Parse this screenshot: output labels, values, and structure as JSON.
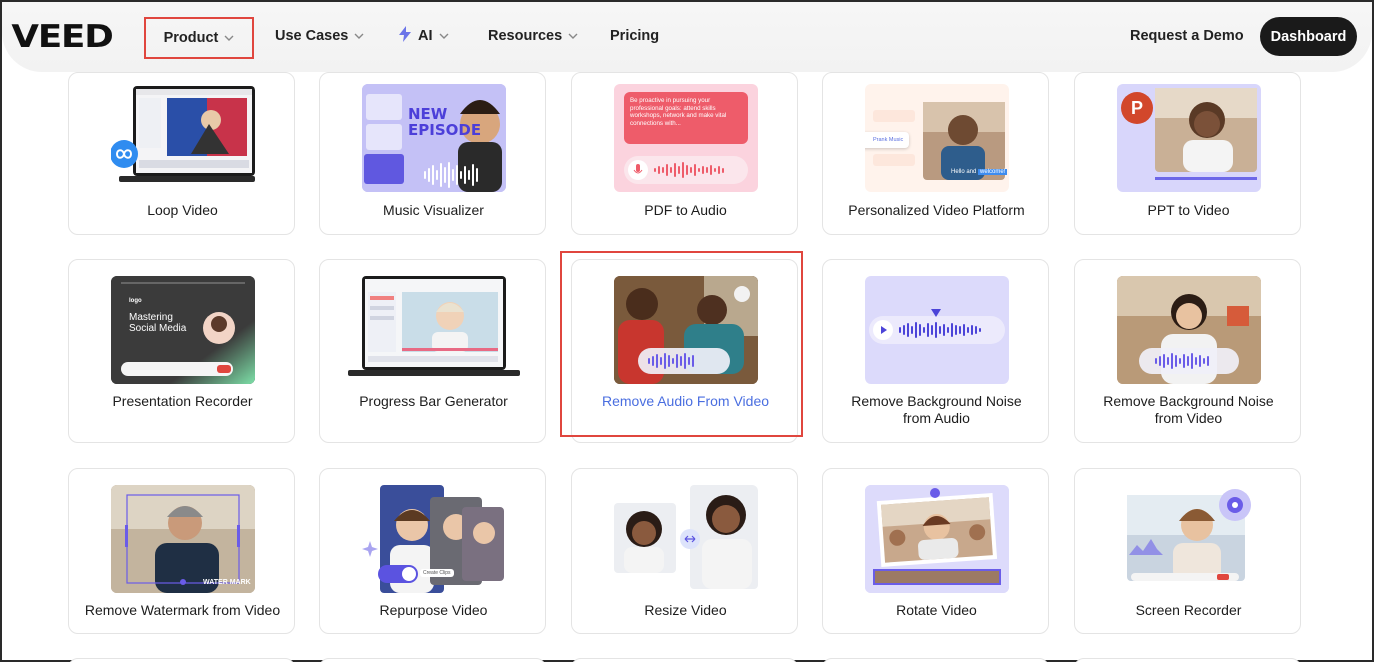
{
  "nav": {
    "logo": "VEED",
    "items": [
      {
        "label": "Product"
      },
      {
        "label": "Use Cases"
      },
      {
        "label": "AI"
      },
      {
        "label": "Resources"
      },
      {
        "label": "Pricing"
      }
    ],
    "demo_label": "Request a Demo",
    "dashboard_label": "Dashboard"
  },
  "cards": [
    {
      "label": "Loop Video"
    },
    {
      "label": "Music Visualizer"
    },
    {
      "label": "PDF to Audio"
    },
    {
      "label": "Personalized Video Platform"
    },
    {
      "label": "PPT to Video"
    },
    {
      "label": "Presentation Recorder"
    },
    {
      "label": "Progress Bar Generator"
    },
    {
      "label": "Remove Audio From Video"
    },
    {
      "label": "Remove Background Noise from Audio"
    },
    {
      "label": "Remove Background Noise from Video"
    },
    {
      "label": "Remove Watermark from Video"
    },
    {
      "label": "Repurpose Video"
    },
    {
      "label": "Resize Video"
    },
    {
      "label": "Rotate Video"
    },
    {
      "label": "Screen Recorder"
    }
  ],
  "thumbs": {
    "music_new": "NEW",
    "music_episode": "EPISODE",
    "pdf_text": "Be proactive in pursuing your professional goals: attend skills workshops, network and make vital connections with...",
    "personal_caption_a": "Hello and",
    "personal_caption_b": "welcome!",
    "personal_chip": "Prank Music",
    "pres_title_a": "Mastering",
    "pres_title_b": "Social Media",
    "pres_logo": "logo",
    "watermark_text": "WATER MARK",
    "repurpose_chip": "Create Clips",
    "ppt_badge": "P"
  },
  "colors": {
    "accent": "#4a6ee0",
    "highlight": "#e0463e",
    "wave": "#6a5ce8"
  }
}
